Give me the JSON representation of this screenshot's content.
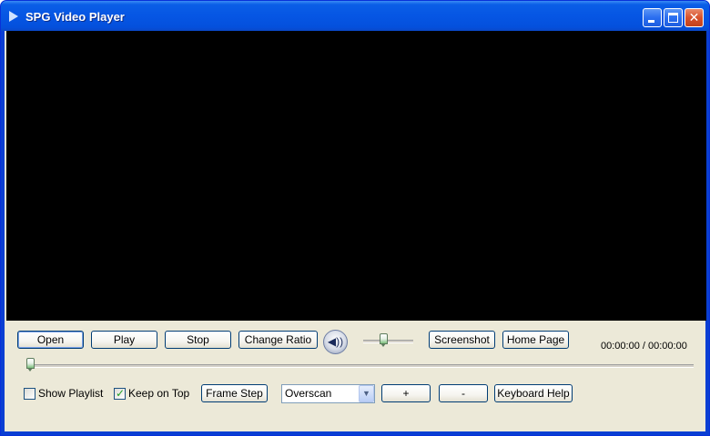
{
  "window": {
    "title": "SPG Video Player",
    "icons": {
      "app": "play-icon",
      "minimize": "minimize-icon",
      "maximize": "maximize-icon",
      "close": "close-icon"
    },
    "close_glyph": "✕"
  },
  "controls": {
    "open_label": "Open",
    "play_label": "Play",
    "stop_label": "Stop",
    "change_ratio_label": "Change Ratio",
    "volume_icon": "speaker-icon",
    "volume_glyph": "◀))",
    "volume_level": 0.4,
    "screenshot_label": "Screenshot",
    "home_page_label": "Home Page",
    "time_display": "00:00:00 / 00:00:00",
    "seek_position": 0.0
  },
  "options": {
    "show_playlist_label": "Show Playlist",
    "show_playlist_checked": false,
    "keep_on_top_label": "Keep on Top",
    "keep_on_top_checked": true,
    "check_glyph": "✓",
    "frame_step_label": "Frame Step",
    "overscan_value": "Overscan",
    "dropdown_glyph": "▼",
    "plus_label": "+",
    "minus_label": "-",
    "keyboard_help_label": "Keyboard Help"
  },
  "colors": {
    "video_background": "#000000",
    "titlebar": "#0656e4",
    "panel": "#ece9d8"
  }
}
